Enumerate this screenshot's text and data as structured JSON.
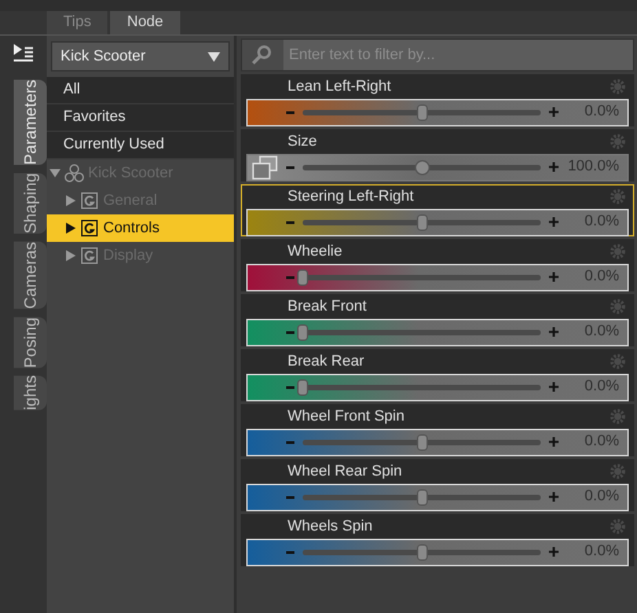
{
  "tabs": [
    {
      "label": "Tips",
      "selected": false
    },
    {
      "label": "Node",
      "selected": true
    }
  ],
  "side_tabs": [
    {
      "label": "Parameters",
      "selected": true
    },
    {
      "label": "Shaping",
      "selected": false
    },
    {
      "label": "Cameras",
      "selected": false
    },
    {
      "label": "Posing",
      "selected": false
    },
    {
      "label": "ights",
      "selected": false
    }
  ],
  "node_select": {
    "value": "Kick Scooter"
  },
  "filters": [
    {
      "label": "All"
    },
    {
      "label": "Favorites"
    },
    {
      "label": "Currently Used"
    }
  ],
  "tree": {
    "label": "Kick Scooter",
    "expanded": true,
    "children": [
      {
        "label": "General",
        "selected": false
      },
      {
        "label": "Controls",
        "selected": true
      },
      {
        "label": "Display",
        "selected": false
      }
    ]
  },
  "search": {
    "placeholder": "Enter text to filter by..."
  },
  "parameters": [
    {
      "name": "Lean Left-Right",
      "kind": "slider",
      "color": "#b4500f",
      "level": 0.5,
      "reading": "0.0%",
      "selected": false
    },
    {
      "name": "Size",
      "kind": "scale",
      "color": "#8a8a8a",
      "level": 0.5,
      "reading": "100.0%",
      "selected": false
    },
    {
      "name": "Steering Left-Right",
      "kind": "slider",
      "color": "#9c8410",
      "level": 0.5,
      "reading": "0.0%",
      "selected": true
    },
    {
      "name": "Wheelie",
      "kind": "slider",
      "color": "#a0103a",
      "level": 0,
      "reading": "0.0%",
      "selected": false
    },
    {
      "name": "Break Front",
      "kind": "slider",
      "color": "#129060",
      "level": 0,
      "reading": "0.0%",
      "selected": false
    },
    {
      "name": "Break Rear",
      "kind": "slider",
      "color": "#129060",
      "level": 0,
      "reading": "0.0%",
      "selected": false
    },
    {
      "name": "Wheel Front Spin",
      "kind": "slider",
      "color": "#155e9c",
      "level": 0.5,
      "reading": "0.0%",
      "selected": false
    },
    {
      "name": "Wheel Rear Spin",
      "kind": "slider",
      "color": "#155e9c",
      "level": 0.5,
      "reading": "0.0%",
      "selected": false
    },
    {
      "name": "Wheels Spin",
      "kind": "slider",
      "color": "#155e9c",
      "level": 0.5,
      "reading": "0.0%",
      "selected": false
    }
  ]
}
